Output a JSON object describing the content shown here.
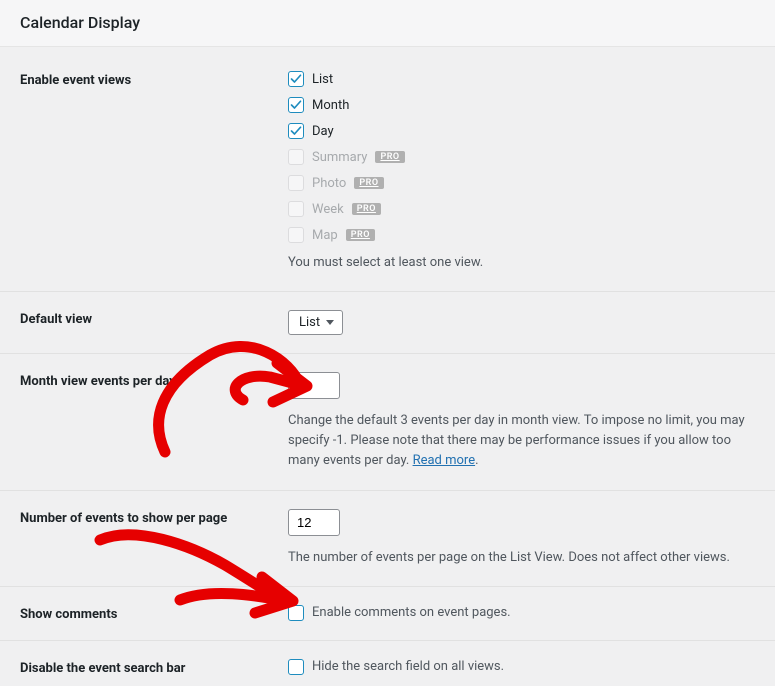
{
  "header": {
    "title": "Calendar Display"
  },
  "rows": {
    "enable_views": {
      "label": "Enable event views",
      "options": {
        "list": {
          "label": "List",
          "checked": true
        },
        "month": {
          "label": "Month",
          "checked": true
        },
        "day": {
          "label": "Day",
          "checked": true
        },
        "summary": {
          "label": "Summary",
          "pro": "PRO"
        },
        "photo": {
          "label": "Photo",
          "pro": "PRO"
        },
        "week": {
          "label": "Week",
          "pro": "PRO"
        },
        "map": {
          "label": "Map",
          "pro": "PRO"
        }
      },
      "helper": "You must select at least one view."
    },
    "default_view": {
      "label": "Default view",
      "value": "List"
    },
    "month_events_per_day": {
      "label": "Month view events per day",
      "value": "3",
      "helper_pre": "Change the default 3 events per day in month view. To impose no limit, you may specify -1. Please note that there may be performance issues if you allow too many events per day. ",
      "helper_link": "Read more",
      "helper_post": "."
    },
    "events_per_page": {
      "label": "Number of events to show per page",
      "value": "12",
      "helper": "The number of events per page on the List View. Does not affect other views."
    },
    "show_comments": {
      "label": "Show comments",
      "checkbox_label": "Enable comments on event pages."
    },
    "disable_search": {
      "label": "Disable the event search bar",
      "checkbox_label": "Hide the search field on all views."
    }
  }
}
